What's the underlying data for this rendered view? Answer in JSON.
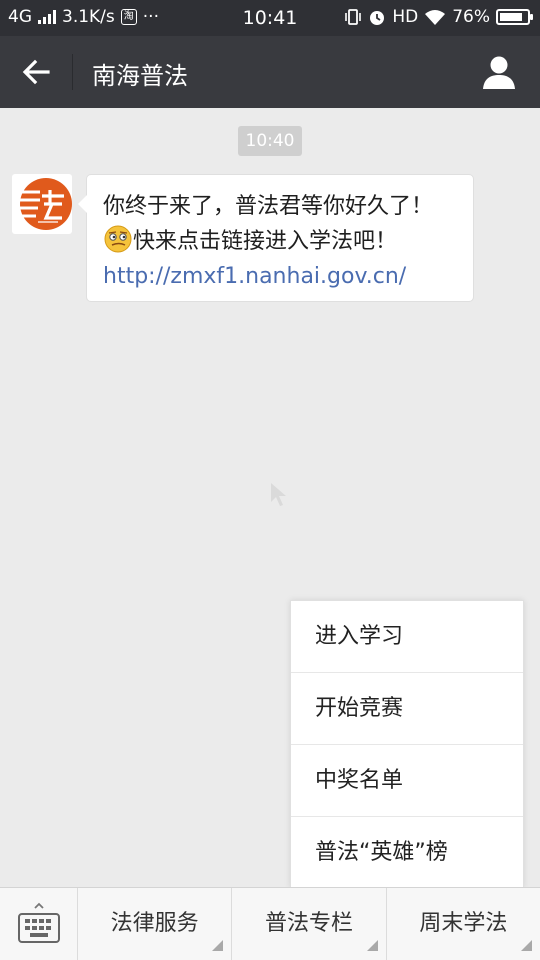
{
  "status_bar": {
    "network": "4G",
    "speed": "3.1K/s",
    "taobao_glyph": "淘",
    "more": "···",
    "time": "10:41",
    "hd": "HD",
    "battery": "76%"
  },
  "header": {
    "title": "南海普法"
  },
  "chat": {
    "timestamp": "10:40",
    "message": {
      "line1": "你终于来了，普法君等你好久了！",
      "line2": "快来点击链接进入学法吧！",
      "link": "http://zmxf1.nanhai.gov.cn/"
    }
  },
  "popup_menu": {
    "items": [
      "进入学习",
      "开始竞赛",
      "中奖名单",
      "普法“英雄”榜"
    ]
  },
  "bottom_bar": {
    "tabs": [
      "法律服务",
      "普法专栏",
      "周末学法"
    ]
  },
  "colors": {
    "title_bar": "#393a3f",
    "status_bar": "#2f3035",
    "chat_bg": "#ebebeb",
    "link": "#4a6cb0",
    "logo_orange": "#e05a1c"
  }
}
